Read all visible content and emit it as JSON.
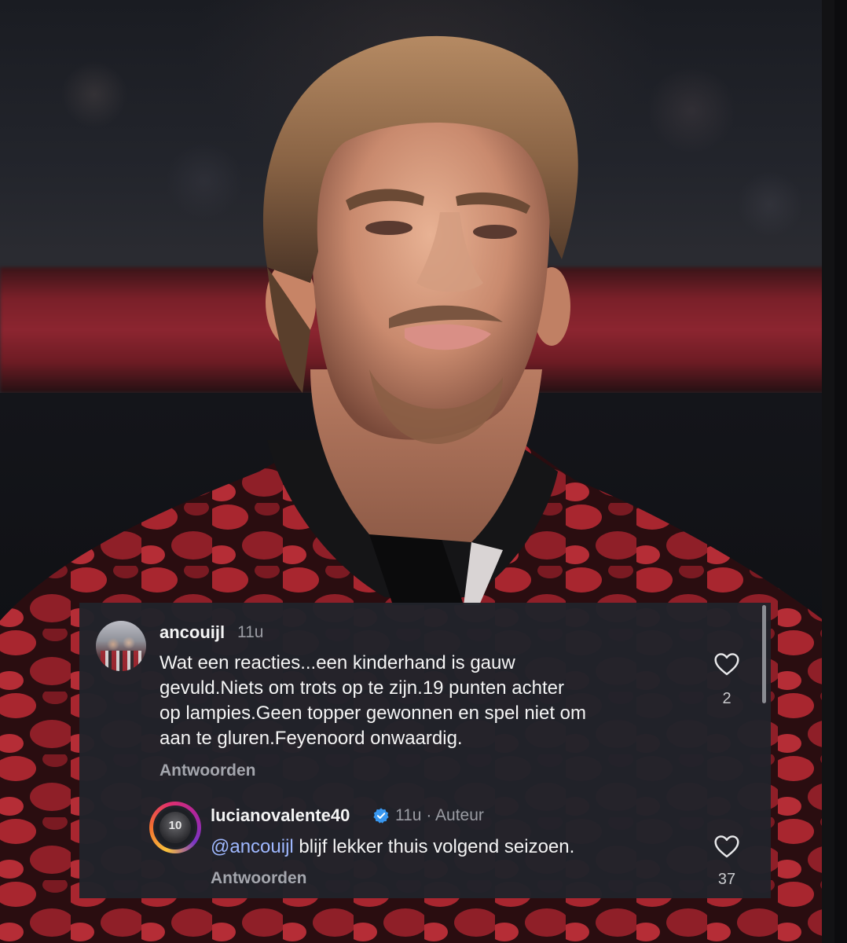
{
  "comments": [
    {
      "username": "ancouijl",
      "time": "11u",
      "text_lines": [
        "Wat een reacties...een kinderhand is gauw",
        "gevuld.Niets om trots op te zijn.19 punten achter",
        "op lampies.Geen topper gewonnen en spel niet om",
        "aan te gluren.Feyenoord onwaardig."
      ],
      "reply_label": "Antwoorden",
      "like_count": "2"
    },
    {
      "username": "lucianovalente40",
      "time": "11u",
      "separator": "·",
      "author_label": "Auteur",
      "mention": "@ancouijl",
      "text": " blijf lekker thuis volgend seizoen.",
      "reply_label": "Antwoorden",
      "like_count": "37",
      "avatar_number": "10"
    }
  ],
  "icons": {
    "like": "heart-icon",
    "verified": "verified-badge-icon"
  },
  "colors": {
    "panel_bg": "#21232a",
    "mention": "#9fb8ff",
    "verified": "#3897f0",
    "jacket_red": "#a8262f"
  }
}
